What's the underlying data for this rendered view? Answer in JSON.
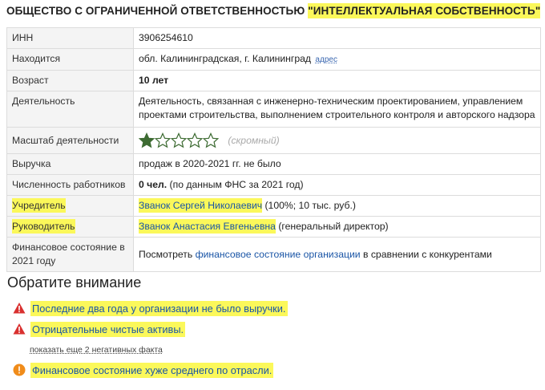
{
  "title": {
    "prefix": "ОБЩЕСТВО С ОГРАНИЧЕННОЙ ОТВЕТСТВЕННОСТЬЮ",
    "name": "\"ИНТЕЛЛЕКТУАЛЬНАЯ СОБСТВЕННОСТЬ\""
  },
  "rows": {
    "inn": {
      "label": "ИНН",
      "value": "3906254610"
    },
    "location": {
      "label": "Находится",
      "value": "обл. Калининградская, г. Калининград",
      "link": "адрес"
    },
    "age": {
      "label": "Возраст",
      "value": "10 лет"
    },
    "activity": {
      "label": "Деятельность",
      "value": "Деятельность, связанная с инженерно-техническим проектированием, управлением проектами строительства, выполнением строительного контроля и авторского надзора"
    },
    "scale": {
      "label": "Масштаб деятельности",
      "rating": 1,
      "max": 5,
      "note": "(скромный)"
    },
    "revenue": {
      "label": "Выручка",
      "value": "продаж в 2020-2021 гг. не было"
    },
    "staff": {
      "label": "Численность работников",
      "value": "0 чел.",
      "note": " (по данным ФНС за 2021 год)"
    },
    "founder": {
      "label": "Учредитель",
      "name": "Званок Сергей Николаевич",
      "note": " (100%; 10 тыс. руб.)"
    },
    "director": {
      "label": "Руководитель",
      "name": "Званок Анастасия Евгеньевна",
      "note": " (генеральный директор)"
    },
    "finance": {
      "label": "Финансовое состояние в 2021 году",
      "pre": "Посмотреть ",
      "link": "финансовое состояние организации",
      "post": " в сравнении с конкурентами"
    }
  },
  "attention": {
    "heading": "Обратите внимание",
    "items": [
      {
        "text": "Последние два года у организации не было выручки.",
        "icon": "warning-triangle-icon",
        "color": "#d9302f"
      },
      {
        "text": "Отрицательные чистые активы.",
        "icon": "warning-triangle-icon",
        "color": "#d9302f"
      },
      {
        "text": "Финансовое состояние хуже среднего по отрасли.",
        "icon": "alert-circle-icon",
        "color": "#f08c1a"
      }
    ],
    "more": "показать еще 2 негативных факта"
  },
  "colors": {
    "highlight": "#fbf85a",
    "link": "#1a55a6",
    "star": "#3d6b32"
  }
}
